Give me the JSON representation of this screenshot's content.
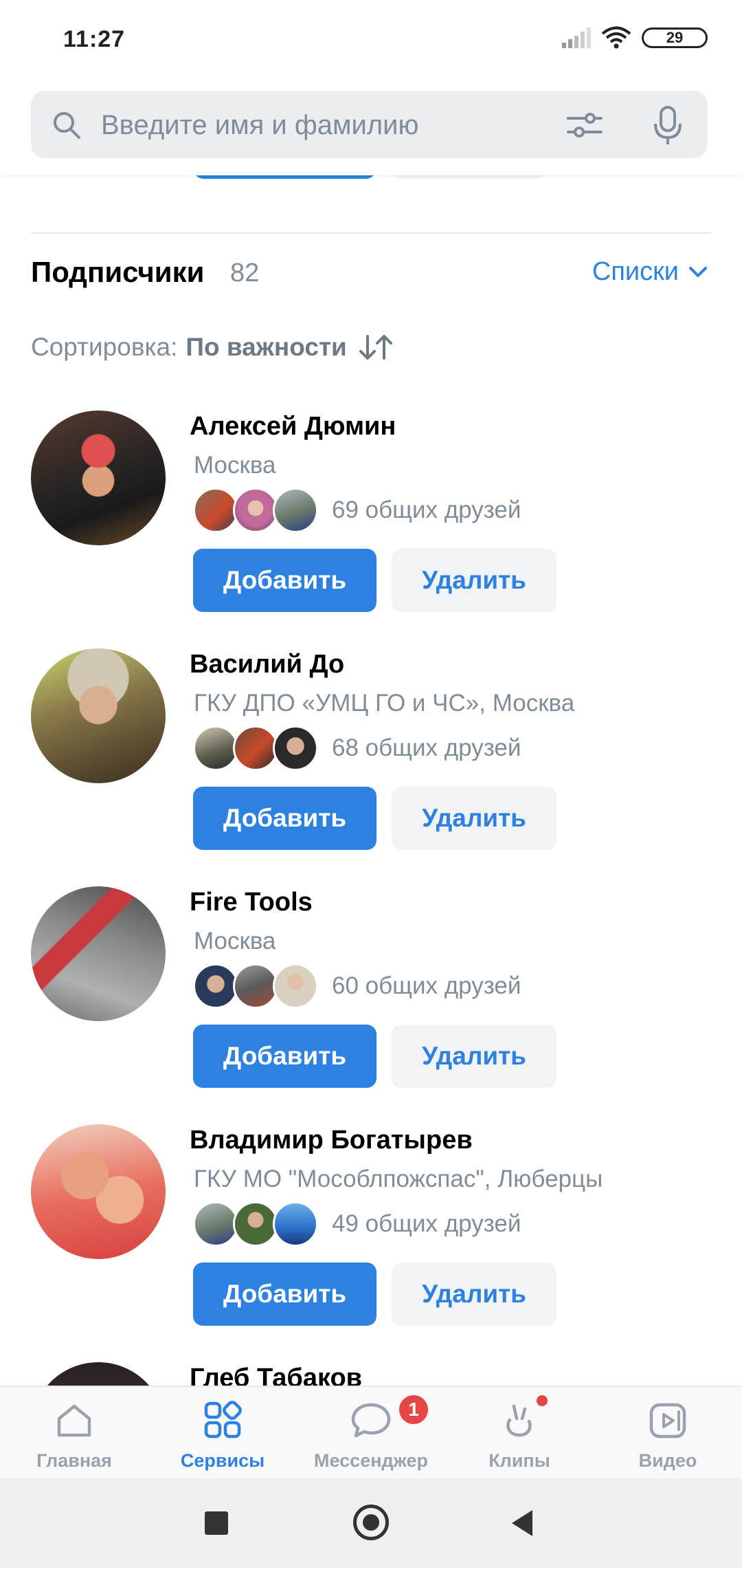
{
  "status": {
    "time": "11:27",
    "battery": "29"
  },
  "search": {
    "placeholder": "Введите имя и фамилию"
  },
  "section": {
    "title": "Подписчики",
    "count": "82",
    "lists_label": "Списки"
  },
  "sort": {
    "label": "Сортировка:",
    "value": "По важности"
  },
  "users": [
    {
      "name": "Алексей Дюмин",
      "city": "Москва",
      "mutual": "69 общих друзей",
      "add": "Добавить",
      "remove": "Удалить"
    },
    {
      "name": "Василий До",
      "city": "ГКУ ДПО «УМЦ ГО и ЧС», Москва",
      "mutual": "68 общих друзей",
      "add": "Добавить",
      "remove": "Удалить"
    },
    {
      "name": "Fire Tools",
      "city": "Москва",
      "mutual": "60 общих друзей",
      "add": "Добавить",
      "remove": "Удалить"
    },
    {
      "name": "Владимир Богатырев",
      "city": "ГКУ МО \"Мособлпожспас\", Люберцы",
      "mutual": "49 общих друзей",
      "add": "Добавить",
      "remove": "Удалить"
    },
    {
      "name": "Глеб Табаков"
    }
  ],
  "tabs": [
    {
      "label": "Главная",
      "icon": "home-icon"
    },
    {
      "label": "Сервисы",
      "icon": "services-icon"
    },
    {
      "label": "Мессенджер",
      "icon": "messenger-icon",
      "badge": "1"
    },
    {
      "label": "Клипы",
      "icon": "clips-icon"
    },
    {
      "label": "Видео",
      "icon": "video-icon"
    }
  ],
  "colors": {
    "accent": "#2d81e0",
    "secondary_text": "#818c99",
    "badge": "#e64646"
  }
}
